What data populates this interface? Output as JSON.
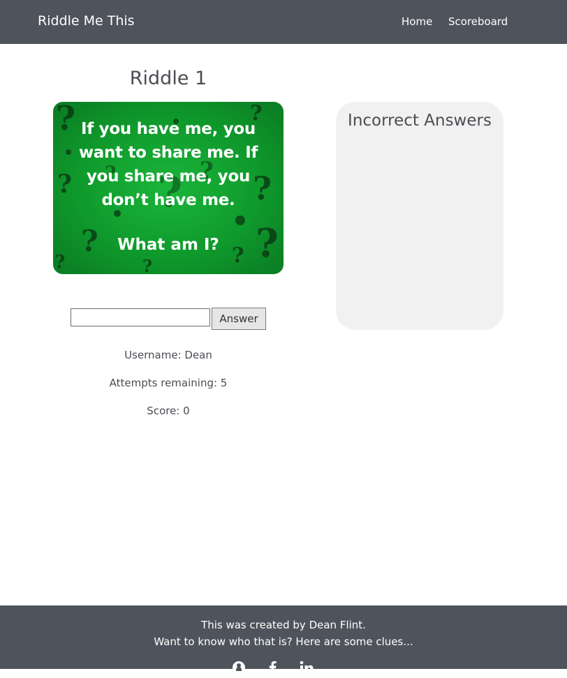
{
  "navbar": {
    "brand": "Riddle Me This",
    "links": [
      {
        "label": "Home"
      },
      {
        "label": "Scoreboard"
      }
    ]
  },
  "riddle": {
    "title": "Riddle 1",
    "image_text": "If you have me, you want to share me. If you share me, you don’t have me.",
    "image_question": "What am I?",
    "image_colors": {
      "background": "#12a732",
      "marks": "#0a3d14"
    }
  },
  "answer_form": {
    "input_value": "",
    "button_label": "Answer"
  },
  "stats": {
    "username": "Username: Dean",
    "attempts": "Attempts remaining: 5",
    "score": "Score: 0"
  },
  "incorrect": {
    "title": "Incorrect Answers",
    "items": []
  },
  "footer": {
    "line1": "This was created by Dean Flint.",
    "line2": "Want to know who that is? Here are some clues...",
    "icons": [
      "github-icon",
      "facebook-icon",
      "linkedin-icon"
    ]
  },
  "colors": {
    "navbar": "#4f545c",
    "panel": "#f1f1f1",
    "text": "#4a4d53"
  }
}
